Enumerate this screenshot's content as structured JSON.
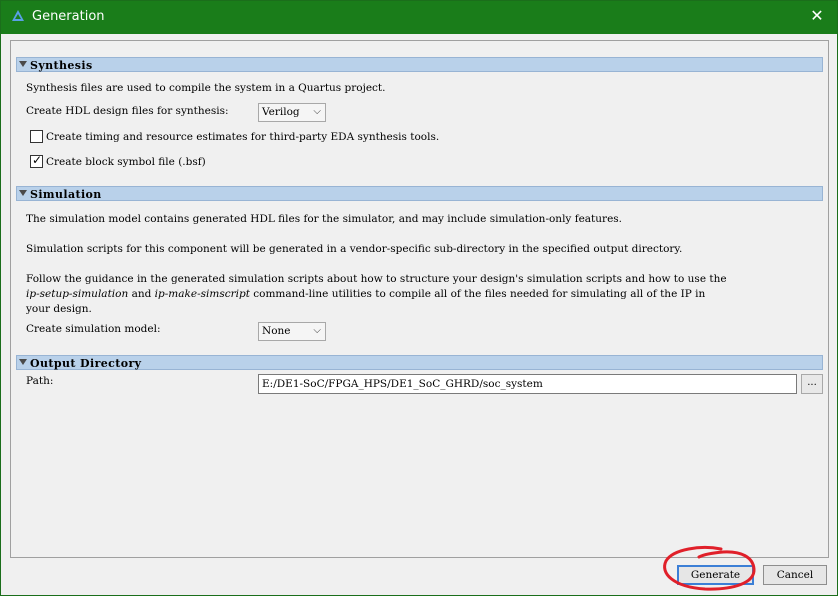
{
  "window": {
    "title": "Generation",
    "close_glyph": "✕",
    "icon": "quartus-triangle-icon"
  },
  "synthesis": {
    "header": "Synthesis",
    "description": "Synthesis files are used to compile the system in a Quartus project.",
    "hdl_label": "Create HDL design files for synthesis:",
    "hdl_value": "Verilog",
    "timing_label": "Create timing and resource estimates for third-party EDA synthesis tools.",
    "timing_checked": false,
    "bsf_label": "Create block symbol file (.bsf)",
    "bsf_checked": true
  },
  "simulation": {
    "header": "Simulation",
    "line1": "The simulation model contains generated HDL files for the simulator, and may include simulation-only features.",
    "line2": "Simulation scripts for this component will be generated in a vendor-specific sub-directory in the specified output directory.",
    "line3a": "Follow the guidance in the generated simulation scripts about how to structure your design's simulation scripts and how to use the",
    "line3b_italic1": "ip-setup-simulation",
    "line3b_mid": " and ",
    "line3b_italic2": "ip-make-simscript",
    "line3b_rest": " command-line utilities to compile all of the files needed for simulating all of the IP in",
    "line3c": "your design.",
    "model_label": "Create simulation model:",
    "model_value": "None"
  },
  "output": {
    "header": "Output Directory",
    "path_label": "Path:",
    "path_value": "E:/DE1-SoC/FPGA_HPS/DE1_SoC_GHRD/soc_system",
    "browse_label": "..."
  },
  "buttons": {
    "generate": "Generate",
    "cancel": "Cancel"
  },
  "colors": {
    "titlebar": "#1a7d1a",
    "section_header": "#b9d1ea",
    "annotation": "#e0202a"
  }
}
